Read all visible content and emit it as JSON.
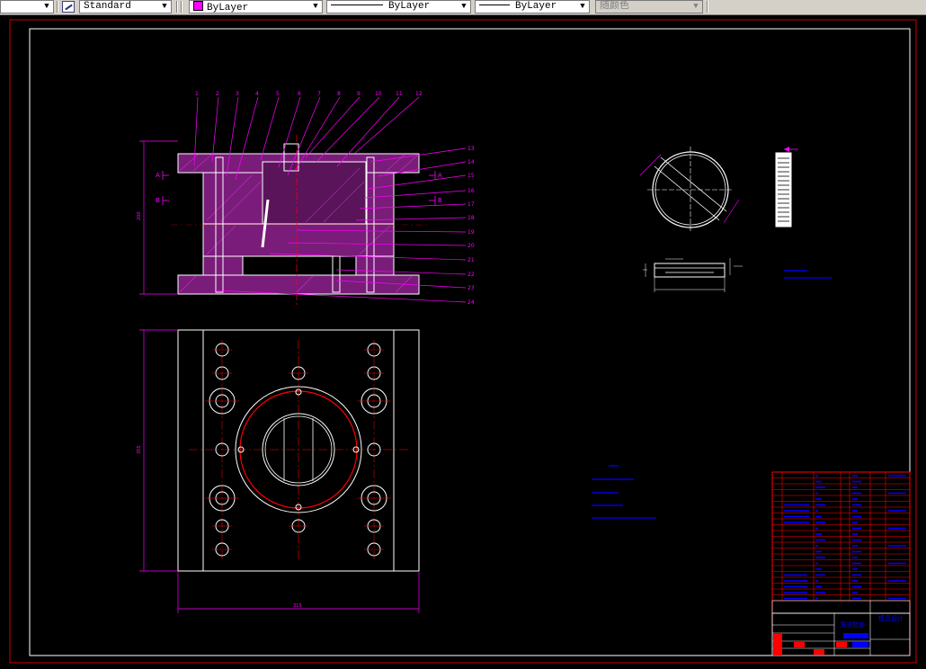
{
  "toolbar": {
    "dropdown_arrow": "chevron-down-icon",
    "text_style": "Standard",
    "layer": "ByLayer",
    "layer_color": "#ff00ff",
    "linetype": "ByLayer",
    "lineweight": "ByLayer",
    "plot_style": "随颜色"
  },
  "drawing": {
    "colors": {
      "frame": "#ffffff",
      "outer_border": "#cc0000",
      "dimension": "#ff00ff",
      "centerline": "#ff0000",
      "note_text": "#0000ff",
      "title_block": "#ff0000"
    },
    "part_numbers_top": [
      "1",
      "2",
      "3",
      "4",
      "5",
      "6",
      "7",
      "8",
      "9",
      "10",
      "11",
      "12"
    ],
    "part_numbers_right": [
      "13",
      "14",
      "15",
      "16",
      "17",
      "18",
      "19",
      "20",
      "21",
      "22",
      "23",
      "24"
    ],
    "section_labels": [
      "A",
      "B",
      "A",
      "B"
    ],
    "dim_height_front": "200",
    "dim_height_plan": "355",
    "dim_width_plan": "315",
    "title_name": "洗洁精盖",
    "title_dept": "模具设计"
  }
}
